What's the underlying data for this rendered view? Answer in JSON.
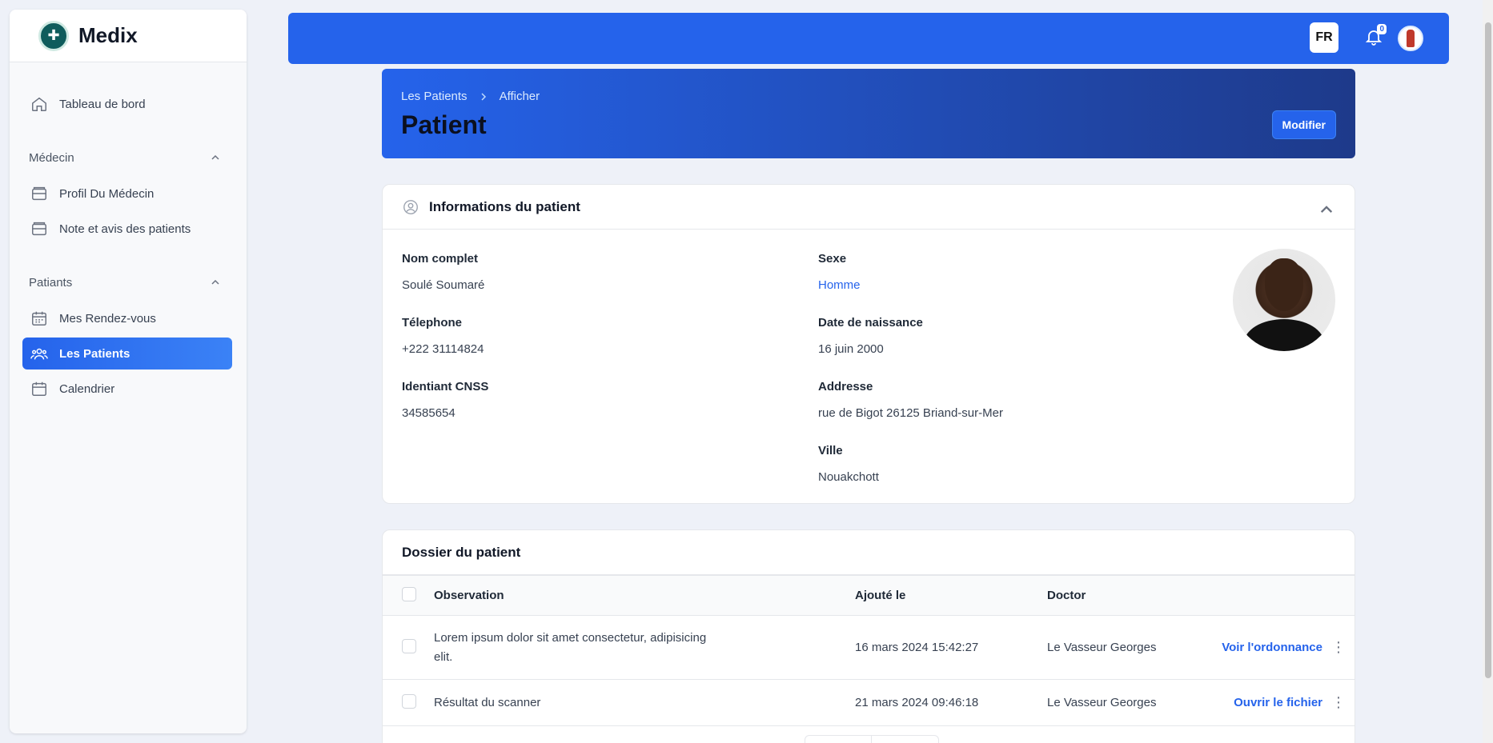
{
  "app": {
    "name": "Medix",
    "logo_icon": "medical-logo-icon"
  },
  "sidebar": {
    "dashboard": {
      "label": "Tableau de bord",
      "icon": "home-icon"
    },
    "groups": [
      {
        "label": "Médecin",
        "items": [
          {
            "label": "Profil Du Médecin",
            "icon": "folder-icon"
          },
          {
            "label": "Note et avis des patients",
            "icon": "folder-icon"
          }
        ]
      },
      {
        "label": "Patiants",
        "items": [
          {
            "label": "Mes Rendez-vous",
            "icon": "calendar-icon"
          },
          {
            "label": "Les Patients",
            "icon": "users-icon",
            "active": true
          },
          {
            "label": "Calendrier",
            "icon": "calendar-icon"
          }
        ]
      }
    ]
  },
  "topbar": {
    "lang": "FR",
    "notifications": "0"
  },
  "header": {
    "breadcrumb": [
      "Les Patients",
      "Afficher"
    ],
    "title": "Patient",
    "edit_label": "Modifier"
  },
  "patient": {
    "section_title": "Informations du patient",
    "fields": {
      "full_name": {
        "label": "Nom complet",
        "value": "Soulé Soumaré"
      },
      "sex": {
        "label": "Sexe",
        "value": "Homme"
      },
      "phone": {
        "label": "Télephone",
        "value": "+222 31114824"
      },
      "birth": {
        "label": "Date de naissance",
        "value": "16 juin 2000"
      },
      "cnss": {
        "label": "Identiant CNSS",
        "value": "34585654"
      },
      "address": {
        "label": "Addresse",
        "value": "rue de Bigot 26125 Briand-sur-Mer"
      },
      "city": {
        "label": "Ville",
        "value": "Nouakchott"
      }
    }
  },
  "records": {
    "title": "Dossier du patient",
    "columns": [
      "Observation",
      "Ajouté le",
      "Doctor"
    ],
    "rows": [
      {
        "observation": "Lorem ipsum dolor sit amet consectetur, adipisicing elit.",
        "added": "16 mars 2024 15:42:27",
        "doctor": "Le Vasseur Georges",
        "action": "Voir l'ordonnance"
      },
      {
        "observation": "Résultat du scanner",
        "added": "21 mars 2024 09:46:18",
        "doctor": "Le Vasseur Georges",
        "action": "Ouvrir le fichier"
      }
    ]
  },
  "colors": {
    "primary": "#2563eb",
    "banner_end": "#1e3a8a",
    "background": "#eef1f8"
  }
}
